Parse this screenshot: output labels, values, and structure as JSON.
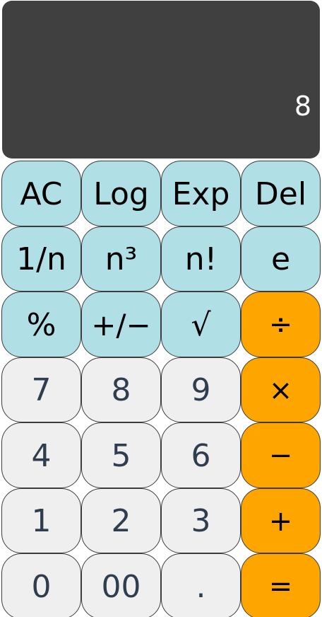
{
  "display": {
    "value": "8"
  },
  "keys": {
    "ac": "AC",
    "log": "Log",
    "exp": "Exp",
    "del": "Del",
    "reciprocal": "1/n",
    "cube": "n³",
    "factorial": "n!",
    "euler": "e",
    "percent": "%",
    "sign": "+/−",
    "sqrt": "√",
    "divide": "÷",
    "seven": "7",
    "eight": "8",
    "nine": "9",
    "multiply": "×",
    "four": "4",
    "five": "5",
    "six": "6",
    "minus": "−",
    "one": "1",
    "two": "2",
    "three": "3",
    "plus": "+",
    "zero": "0",
    "double_zero": "00",
    "decimal": ".",
    "equals": "="
  },
  "colors": {
    "display_bg": "#404040",
    "function_key": "#b0dfe5",
    "number_key": "#efefef",
    "operator_key": "#ffa500"
  }
}
